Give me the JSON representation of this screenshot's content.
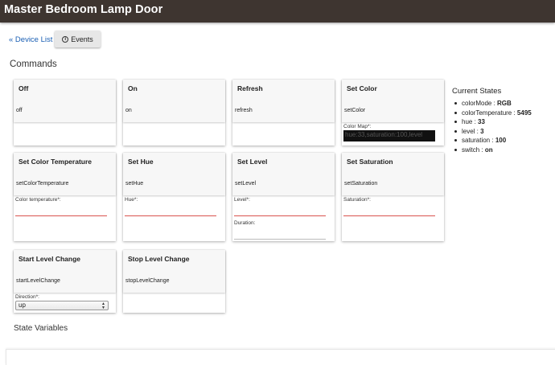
{
  "header": {
    "title": "Master Bedroom Lamp Door"
  },
  "nav": {
    "device_list_label": "« Device List",
    "events_label": "Events",
    "events_icon": "info-icon"
  },
  "commands": {
    "title": "Commands",
    "cards": [
      {
        "name": "Off",
        "command": "off"
      },
      {
        "name": "On",
        "command": "on"
      },
      {
        "name": "Refresh",
        "command": "refresh"
      },
      {
        "name": "Set Color",
        "command": "setColor",
        "field_label": "Color Map*:",
        "field_value": "hue:33,saturation:100,level"
      },
      {
        "name": "Set Color Temperature",
        "command": "setColorTemperature",
        "field_label": "Color temperature*:"
      },
      {
        "name": "Set Hue",
        "command": "setHue",
        "field_label": "Hue*:"
      },
      {
        "name": "Set Level",
        "command": "setLevel",
        "field_label": "Level*:",
        "field2_label": "Duration:"
      },
      {
        "name": "Set Saturation",
        "command": "setSaturation",
        "field_label": "Saturation*:"
      },
      {
        "name": "Start Level Change",
        "command": "startLevelChange",
        "field_label": "Direction*:",
        "select_value": "up"
      },
      {
        "name": "Stop Level Change",
        "command": "stopLevelChange"
      }
    ]
  },
  "current_states": {
    "title": "Current States",
    "items": [
      {
        "key": "colorMode",
        "value": "RGB"
      },
      {
        "key": "colorTemperature",
        "value": "5495"
      },
      {
        "key": "hue",
        "value": "33"
      },
      {
        "key": "level",
        "value": "3"
      },
      {
        "key": "saturation",
        "value": "100"
      },
      {
        "key": "switch",
        "value": "on"
      }
    ]
  },
  "state_variables": {
    "title": "State Variables"
  },
  "colors": {
    "header_bg": "#3e3530",
    "link": "#1a5fb4",
    "required_underline": "#d9534f"
  }
}
